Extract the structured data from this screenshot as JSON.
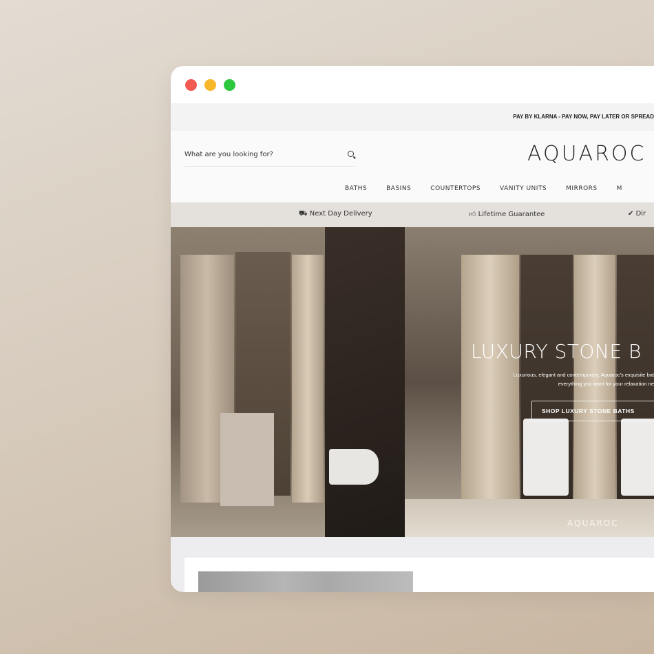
{
  "window": {
    "controls": [
      {
        "name": "close",
        "color": "#f25a52"
      },
      {
        "name": "minimize",
        "color": "#f6b72a"
      },
      {
        "name": "maximize",
        "color": "#2ec840"
      }
    ]
  },
  "announcement": "PAY BY KLARNA - PAY NOW, PAY LATER OR SPREAD",
  "header": {
    "search_placeholder": "What are you looking for?",
    "logo": "AQUAROC"
  },
  "nav": [
    "BATHS",
    "BASINS",
    "COUNTERTOPS",
    "VANITY UNITS",
    "MIRRORS",
    "M"
  ],
  "features": [
    {
      "icon": "truck-icon",
      "label": "Next Day Delivery"
    },
    {
      "icon": "thumbs-up-icon",
      "label": "Lifetime Guarantee"
    },
    {
      "icon": "check-badge-icon",
      "label": "Dir"
    }
  ],
  "hero": {
    "title": "LUXURY STONE B",
    "subtitle_line1": "Luxurious, elegant and contemporary, Aquaroc's exquisite bat",
    "subtitle_line2": "everything you want for your relaxation ne",
    "button": "SHOP LUXURY STONE BATHS",
    "watermark": "AQUAROC"
  }
}
